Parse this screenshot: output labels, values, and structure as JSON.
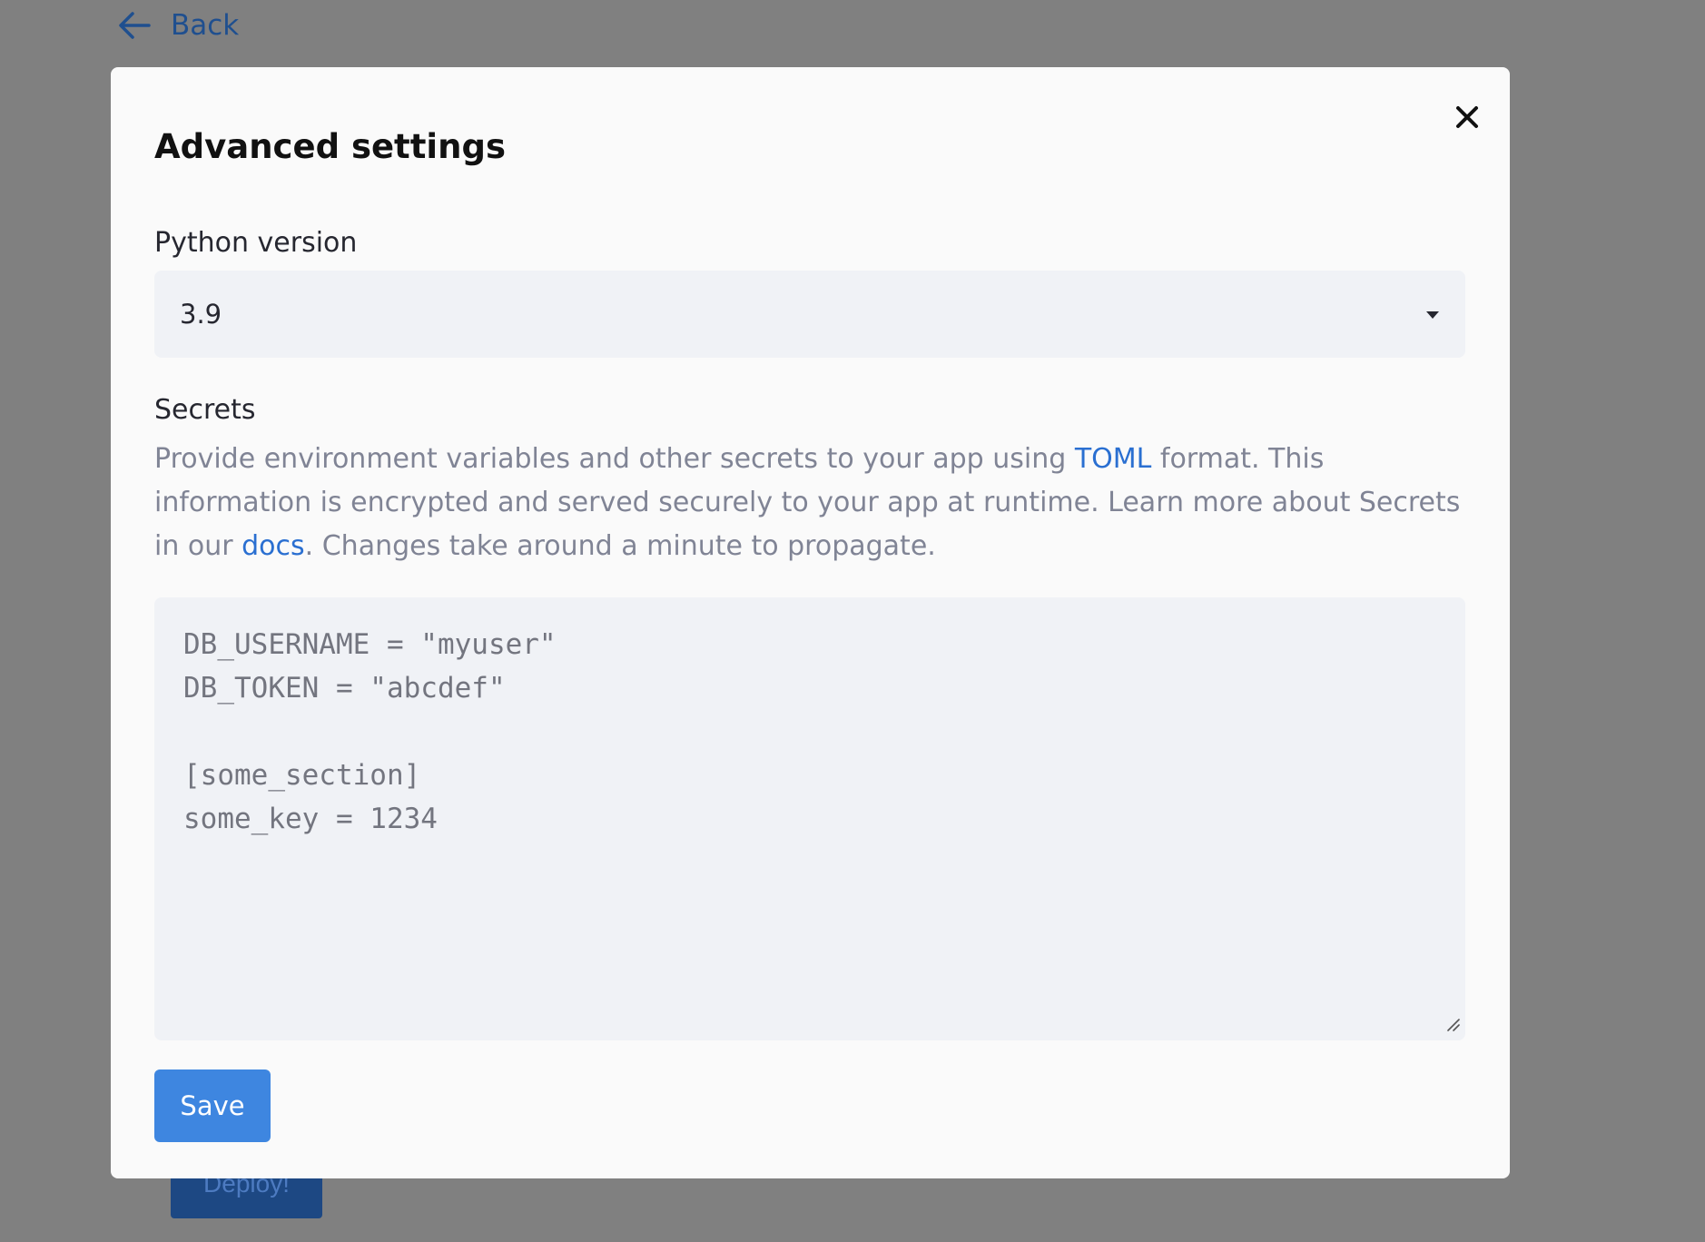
{
  "back": {
    "label": "Back",
    "icon": "arrow-left-icon"
  },
  "background": {
    "deploy_label": "Deploy!"
  },
  "modal": {
    "title": "Advanced settings",
    "close_icon": "close-icon",
    "python_version": {
      "label": "Python version",
      "selected": "3.9",
      "icon": "caret-down-icon"
    },
    "secrets": {
      "label": "Secrets",
      "help_part1": "Provide environment variables and other secrets to your app using ",
      "toml_link": "TOML",
      "help_part2": " format. This information is encrypted and served securely to your app at runtime. Learn more about Secrets in our ",
      "docs_link": "docs",
      "help_part3": ". Changes take around a minute to propagate.",
      "lines": [
        "DB_USERNAME = \"myuser\"",
        "DB_TOKEN = \"abcdef\"",
        "",
        "[some_section]",
        "some_key = 1234"
      ]
    },
    "save_label": "Save"
  },
  "colors": {
    "overlay": "#808080",
    "modal_bg": "#fafafa",
    "field_bg": "#f0f2f6",
    "primary": "#3e86e0",
    "link": "#2a6fd1",
    "back_link": "#1f4f8f"
  }
}
